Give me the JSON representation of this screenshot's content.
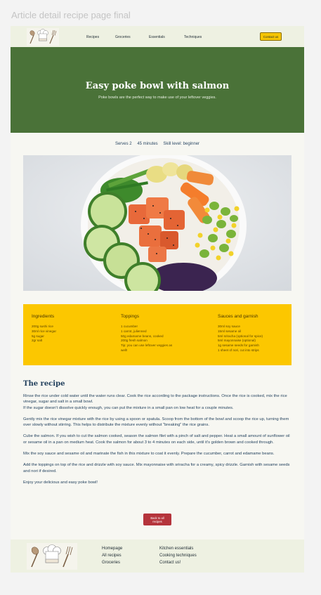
{
  "frame_title": "Article detail recipe page final",
  "header": {
    "nav": [
      "Recipes",
      "Groceries",
      "Essentials",
      "Techniques"
    ],
    "contact_label": "Contact us"
  },
  "hero": {
    "title": "Easy poke bowl with salmon",
    "subtitle": "Poke bowls are the perfect way to make use of your leftover veggies."
  },
  "meta": {
    "serves": "Serves 2",
    "time": "45 minutes",
    "skill": "Skill level: beginner"
  },
  "ingredients": {
    "columns": [
      {
        "heading": "Ingredients",
        "items": [
          "200g sushi rice",
          "30ml rice vinegar",
          "5g sugar",
          "2gr salt"
        ]
      },
      {
        "heading": "Toppings",
        "items": [
          "1 cucumber",
          "1 carrot, julienned",
          "50g edamame beans, cooked",
          "200g fresh salmon",
          "Tip: you can use leftover veggies as",
          "well!"
        ]
      },
      {
        "heading": "Sauces and garnish",
        "items": [
          "30ml soy sauce",
          "15ml sesame oil",
          "5ml sriracha (optional for spice)",
          "5ml mayonnaise (optional)",
          "1g sesame seeds for garnish",
          "1 sheet of nori, cut into strips"
        ]
      }
    ]
  },
  "recipe": {
    "title": "The recipe",
    "paragraphs": [
      "Rinse the rice under cold water until the water runs clear. Cook the rice according to the package instructions. Once the rice is cooked, mix the rice vinegar, sugar and salt in a small bowl.",
      "If the sugar doesn't dissolve quickly enough, you can put the mixture in a small pan on low heat for a couple minutes.",
      "Gently mix the rice vinegar mixture with the rice by using a spoon or spatula. Scoop from the bottom of the bowl and scoop the rice up, turning them over slowly without stirring. This helps to distribute the mixture evenly without \"breaking\" the rice grains.",
      "Cube the salmon. If you wish to cut the salmon cooked, season the salmon filet with a pinch of salt and pepper. Heat a small amount of sunflower oil or sesame oil in a pan on medium heat. Cook the salmon for about 3 to 4 minutes on each side, until it's golden brown and cooked through.",
      "Mix the soy sauce and sesame oil and marinate the fish in this mixture to coat it evenly. Prepare the cucumber, carrot and edamame beans.",
      "Add the toppings on top of the rice and drizzle with soy sauce. Mix mayonnaise with sriracha for a creamy, spicy drizzle. Garnish with sesame seeds and nori if desired.",
      "Enjoy your delicious and easy poke bowl!"
    ],
    "back_label": "Back to all recipes"
  },
  "footer": {
    "col1": [
      "Homepage",
      "All recipes",
      "Groceries"
    ],
    "col2": [
      "Kitchen essentials",
      "Cooking techniques",
      "Contact us!"
    ]
  },
  "colors": {
    "hero_green": "#4a7238",
    "ingredients_yellow": "#fcc700",
    "back_button_red": "#b5343c",
    "header_bg": "#eef1e2"
  },
  "icons": [
    "chef-logo-icon"
  ]
}
